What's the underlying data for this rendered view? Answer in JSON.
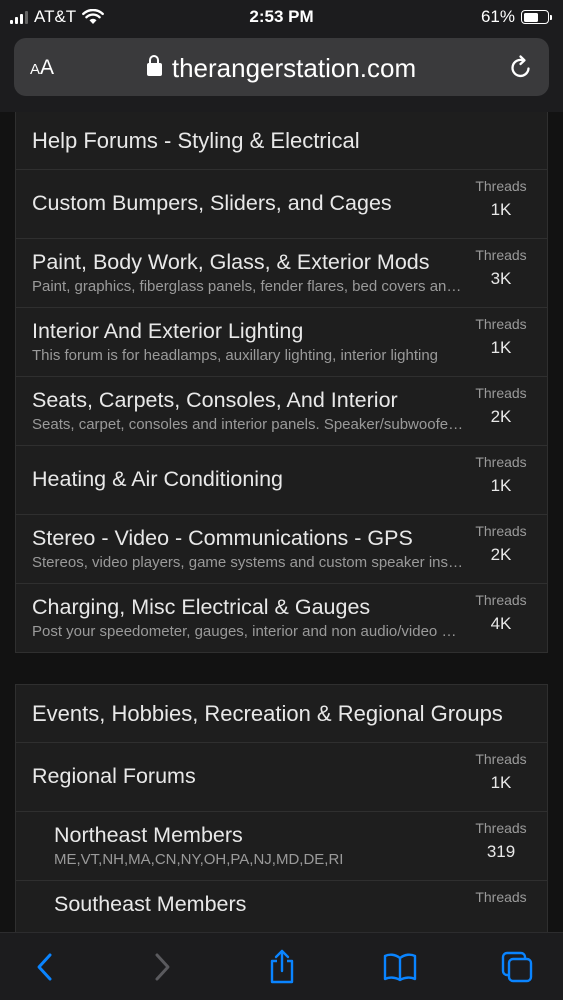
{
  "status_bar": {
    "carrier": "AT&T",
    "time": "2:53 PM",
    "battery": "61%",
    "battery_level": 0.61
  },
  "address_bar": {
    "text_size_label": "AA",
    "domain": "therangerstation.com"
  },
  "sections": [
    {
      "title": "Help Forums - Styling & Electrical",
      "forums": [
        {
          "title": "Custom Bumpers, Sliders, and Cages",
          "desc": "",
          "stat_label": "Threads",
          "stat_value": "1K"
        },
        {
          "title": "Paint, Body Work, Glass, & Exterior Mods",
          "desc": "Paint, graphics, fiberglass panels, fender flares, bed covers and caps",
          "stat_label": "Threads",
          "stat_value": "3K"
        },
        {
          "title": "Interior And Exterior Lighting",
          "desc": "This forum is for headlamps, auxillary lighting, interior lighting",
          "stat_label": "Threads",
          "stat_value": "1K"
        },
        {
          "title": "Seats, Carpets, Consoles, And Interior",
          "desc": "Seats, carpet, consoles and interior panels. Speaker/subwoofer boxes",
          "stat_label": "Threads",
          "stat_value": "2K"
        },
        {
          "title": "Heating & Air Conditioning",
          "desc": "",
          "stat_label": "Threads",
          "stat_value": "1K"
        },
        {
          "title": "Stereo - Video - Communications - GPS",
          "desc": "Stereos, video players, game systems and custom speaker installs",
          "stat_label": "Threads",
          "stat_value": "2K"
        },
        {
          "title": "Charging, Misc Electrical & Gauges",
          "desc": "Post your speedometer, gauges, interior and non audio/video electrical",
          "stat_label": "Threads",
          "stat_value": "4K"
        }
      ]
    },
    {
      "title": "Events, Hobbies, Recreation & Regional Groups",
      "forums": [
        {
          "title": "Regional Forums",
          "desc": "",
          "stat_label": "Threads",
          "stat_value": "1K"
        },
        {
          "title": "Northeast Members",
          "desc": "ME,VT,NH,MA,CN,NY,OH,PA,NJ,MD,DE,RI",
          "stat_label": "Threads",
          "stat_value": "319"
        },
        {
          "title": "Southeast Members",
          "desc": "",
          "stat_label": "Threads",
          "stat_value": ""
        }
      ]
    }
  ],
  "toolbar": {
    "icons": [
      "back-icon",
      "forward-icon",
      "share-icon",
      "bookmarks-icon",
      "tabs-icon"
    ]
  },
  "colors": {
    "background": "#121212",
    "panel": "#1e1e1e",
    "accent": "#0a84ff",
    "text": "#e8e8e8",
    "muted": "#9a9a9a"
  }
}
